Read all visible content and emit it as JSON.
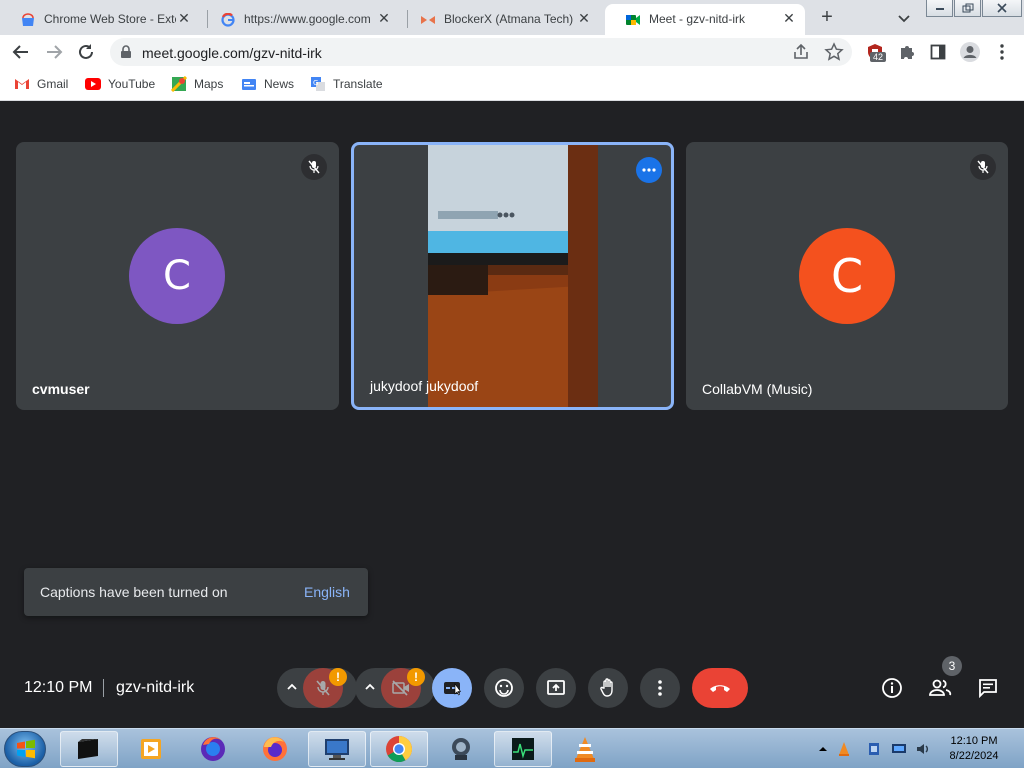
{
  "browser": {
    "tabs": [
      {
        "label": "Chrome Web Store - Exte",
        "icon": "webstore-icon",
        "active": false
      },
      {
        "label": "https://www.google.com",
        "icon": "google-icon",
        "active": false
      },
      {
        "label": "BlockerX (Atmana Tech)",
        "icon": "blockerx-icon",
        "active": false
      },
      {
        "label": "Meet - gzv-nitd-irk",
        "icon": "meet-icon",
        "active": true
      }
    ],
    "new_tab": "+",
    "url": "meet.google.com/gzv-nitd-irk",
    "extension_badge": "42",
    "bookmarks": [
      {
        "label": "Gmail",
        "icon": "gmail-icon"
      },
      {
        "label": "YouTube",
        "icon": "youtube-icon"
      },
      {
        "label": "Maps",
        "icon": "maps-icon"
      },
      {
        "label": "News",
        "icon": "news-icon"
      },
      {
        "label": "Translate",
        "icon": "translate-icon"
      }
    ]
  },
  "meet": {
    "tiles": [
      {
        "name": "cvmuser",
        "avatar_letter": "C",
        "avatar_color": "#7e57c2",
        "muted": true
      },
      {
        "name": "jukydoof jukydoof",
        "video": true,
        "active": true
      },
      {
        "name": "CollabVM (Music)",
        "avatar_letter": "C",
        "avatar_color": "#f4511e",
        "muted": true
      }
    ],
    "toast": {
      "message": "Captions have been turned on",
      "action": "English"
    },
    "time": "12:10 PM",
    "meeting_code": "gzv-nitd-irk",
    "warning_mark": "!",
    "participant_count": "3",
    "colors": {
      "background": "#202124",
      "tile": "#3c4043",
      "accent": "#8ab4f8",
      "hangup": "#ea4335",
      "warning": "#f29900"
    }
  },
  "taskbar": {
    "apps": [
      "terminal-app",
      "media-player-app",
      "firefox-alt-app",
      "firefox-app",
      "remote-desktop-app",
      "chrome-app",
      "network-app",
      "task-manager-app",
      "vlc-app"
    ],
    "time": "12:10 PM",
    "date": "8/22/2024"
  }
}
